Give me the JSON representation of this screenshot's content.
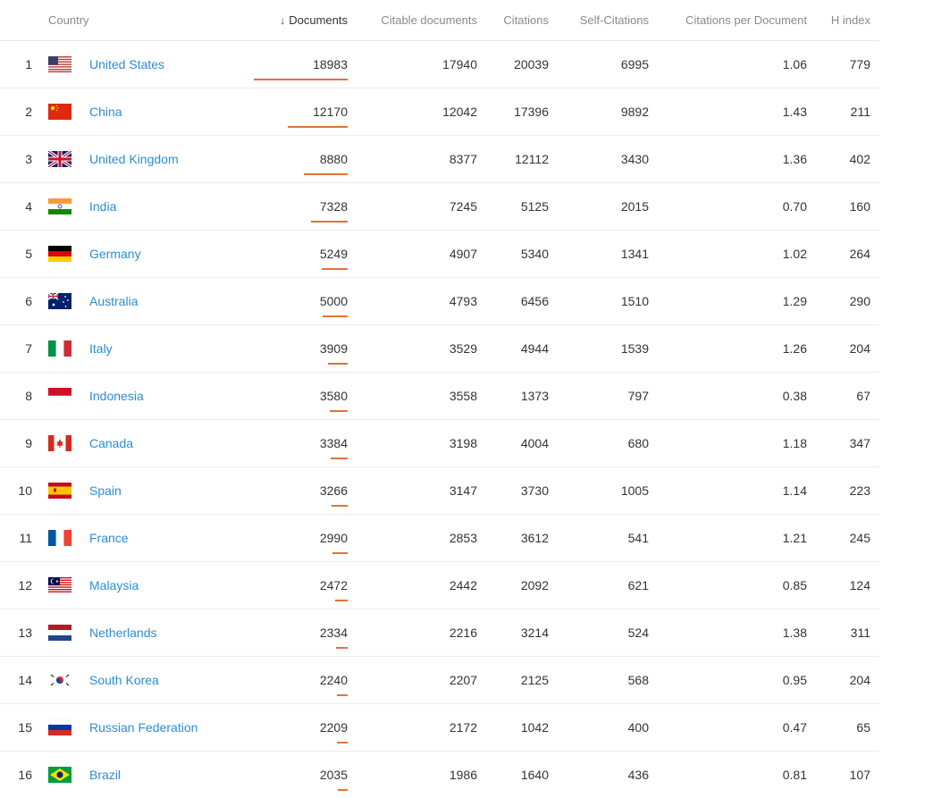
{
  "headers": {
    "country": "Country",
    "documents_arrow": "↓",
    "documents": "Documents",
    "citable": "Citable documents",
    "citations": "Citations",
    "self_citations": "Self-Citations",
    "cpd": "Citations per Document",
    "h_index": "H index"
  },
  "bar_color": "#e0733a",
  "link_color": "#2a8dd4",
  "rows": [
    {
      "rank": "1",
      "flag": "us-flag-icon",
      "country": "United States",
      "documents": "18983",
      "citable": "17940",
      "citations": "20039",
      "self_citations": "6995",
      "cpd": "1.06",
      "h_index": "779"
    },
    {
      "rank": "2",
      "flag": "cn-flag-icon",
      "country": "China",
      "documents": "12170",
      "citable": "12042",
      "citations": "17396",
      "self_citations": "9892",
      "cpd": "1.43",
      "h_index": "211"
    },
    {
      "rank": "3",
      "flag": "gb-flag-icon",
      "country": "United Kingdom",
      "documents": "8880",
      "citable": "8377",
      "citations": "12112",
      "self_citations": "3430",
      "cpd": "1.36",
      "h_index": "402"
    },
    {
      "rank": "4",
      "flag": "in-flag-icon",
      "country": "India",
      "documents": "7328",
      "citable": "7245",
      "citations": "5125",
      "self_citations": "2015",
      "cpd": "0.70",
      "h_index": "160"
    },
    {
      "rank": "5",
      "flag": "de-flag-icon",
      "country": "Germany",
      "documents": "5249",
      "citable": "4907",
      "citations": "5340",
      "self_citations": "1341",
      "cpd": "1.02",
      "h_index": "264"
    },
    {
      "rank": "6",
      "flag": "au-flag-icon",
      "country": "Australia",
      "documents": "5000",
      "citable": "4793",
      "citations": "6456",
      "self_citations": "1510",
      "cpd": "1.29",
      "h_index": "290"
    },
    {
      "rank": "7",
      "flag": "it-flag-icon",
      "country": "Italy",
      "documents": "3909",
      "citable": "3529",
      "citations": "4944",
      "self_citations": "1539",
      "cpd": "1.26",
      "h_index": "204"
    },
    {
      "rank": "8",
      "flag": "id-flag-icon",
      "country": "Indonesia",
      "documents": "3580",
      "citable": "3558",
      "citations": "1373",
      "self_citations": "797",
      "cpd": "0.38",
      "h_index": "67"
    },
    {
      "rank": "9",
      "flag": "ca-flag-icon",
      "country": "Canada",
      "documents": "3384",
      "citable": "3198",
      "citations": "4004",
      "self_citations": "680",
      "cpd": "1.18",
      "h_index": "347"
    },
    {
      "rank": "10",
      "flag": "es-flag-icon",
      "country": "Spain",
      "documents": "3266",
      "citable": "3147",
      "citations": "3730",
      "self_citations": "1005",
      "cpd": "1.14",
      "h_index": "223"
    },
    {
      "rank": "11",
      "flag": "fr-flag-icon",
      "country": "France",
      "documents": "2990",
      "citable": "2853",
      "citations": "3612",
      "self_citations": "541",
      "cpd": "1.21",
      "h_index": "245"
    },
    {
      "rank": "12",
      "flag": "my-flag-icon",
      "country": "Malaysia",
      "documents": "2472",
      "citable": "2442",
      "citations": "2092",
      "self_citations": "621",
      "cpd": "0.85",
      "h_index": "124"
    },
    {
      "rank": "13",
      "flag": "nl-flag-icon",
      "country": "Netherlands",
      "documents": "2334",
      "citable": "2216",
      "citations": "3214",
      "self_citations": "524",
      "cpd": "1.38",
      "h_index": "311"
    },
    {
      "rank": "14",
      "flag": "kr-flag-icon",
      "country": "South Korea",
      "documents": "2240",
      "citable": "2207",
      "citations": "2125",
      "self_citations": "568",
      "cpd": "0.95",
      "h_index": "204"
    },
    {
      "rank": "15",
      "flag": "ru-flag-icon",
      "country": "Russian Federation",
      "documents": "2209",
      "citable": "2172",
      "citations": "1042",
      "self_citations": "400",
      "cpd": "0.47",
      "h_index": "65"
    },
    {
      "rank": "16",
      "flag": "br-flag-icon",
      "country": "Brazil",
      "documents": "2035",
      "citable": "1986",
      "citations": "1640",
      "self_citations": "436",
      "cpd": "0.81",
      "h_index": "107"
    }
  ]
}
